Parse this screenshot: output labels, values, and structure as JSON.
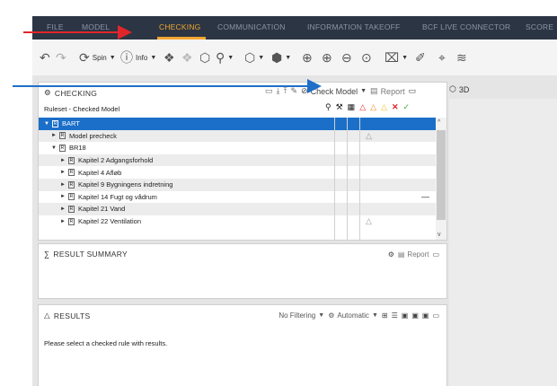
{
  "topbar": {
    "tabs": [
      "FILE",
      "MODEL",
      "CHECKING",
      "COMMUNICATION",
      "INFORMATION TAKEOFF",
      "BCF LIVE CONNECTOR",
      "SCORE",
      "+"
    ],
    "active": "CHECKING",
    "colors": {
      "bg": "#2b3543",
      "active": "#f0a632",
      "inactive": "#8b94a3"
    }
  },
  "toolbar": {
    "spin_label": "Spin",
    "info_label": "Info",
    "icons": [
      "undo-icon",
      "redo-icon",
      "spin-icon",
      "info-icon",
      "select-objects-icon",
      "hide-icon",
      "isolate-icon",
      "visibility-icon",
      "box-icon",
      "cube-icon",
      "zoom-fit-icon",
      "zoom-in-icon",
      "zoom-out-icon",
      "zoom-selected-icon",
      "section-icon",
      "measure-icon",
      "map-icon",
      "layers-icon"
    ]
  },
  "checking": {
    "title": "CHECKING",
    "check_model_label": "Check Model",
    "report_label": "Report",
    "ruleset_label": "Ruleset - Checked Model",
    "tree": [
      {
        "label": "BART",
        "level": 0,
        "expanded": true,
        "selected": true,
        "status": ""
      },
      {
        "label": "Model precheck",
        "level": 1,
        "expanded": false,
        "selected": false,
        "status": "△"
      },
      {
        "label": "BR18",
        "level": 1,
        "expanded": true,
        "selected": false,
        "status": ""
      },
      {
        "label": "Kapitel 2 Adgangsforhold",
        "level": 2,
        "expanded": false,
        "selected": false,
        "status": ""
      },
      {
        "label": "Kapitel 4 Afløb",
        "level": 2,
        "expanded": false,
        "selected": false,
        "status": ""
      },
      {
        "label": "Kapitel 9 Bygningens indretning",
        "level": 2,
        "expanded": false,
        "selected": false,
        "status": ""
      },
      {
        "label": "Kapitel 14 Fugt og vådrum",
        "level": 2,
        "expanded": false,
        "selected": false,
        "status": "—"
      },
      {
        "label": "Kapitel 21 Vand",
        "level": 2,
        "expanded": false,
        "selected": false,
        "status": ""
      },
      {
        "label": "Kapitel 22 Ventilation",
        "level": 2,
        "expanded": false,
        "selected": false,
        "status": "△"
      }
    ],
    "column_icons": [
      "rule-params-icon",
      "rule-type-icon",
      "table-icon",
      "critical-icon",
      "moderate-icon",
      "low-icon",
      "failed-icon",
      "passed-icon"
    ],
    "column_colors": {
      "critical": "#e0262b",
      "moderate": "#f28a1e",
      "low": "#f3c21a",
      "failed": "#e0262b",
      "passed": "#3cae43"
    }
  },
  "summary": {
    "title": "RESULT SUMMARY",
    "report_label": "Report"
  },
  "results": {
    "title": "RESULTS",
    "filter_label": "No Filtering",
    "automatic_label": "Automatic",
    "message": "Please select a checked rule with results."
  },
  "side": {
    "view_label": "3D"
  }
}
